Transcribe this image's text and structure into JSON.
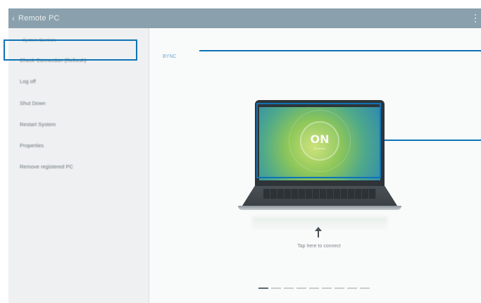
{
  "app": {
    "title": "Remote PC"
  },
  "sidebar": {
    "section_label": "System Controls",
    "items": [
      {
        "label": "Check Connection (Refresh)"
      },
      {
        "label": "Log off"
      },
      {
        "label": "Shut Down"
      },
      {
        "label": "Restart System"
      },
      {
        "label": "Properties"
      },
      {
        "label": "Remove registered PC"
      }
    ]
  },
  "main": {
    "pc_name": "BYNC",
    "screen": {
      "status": "ON",
      "substatus": "Available"
    },
    "hint": "Tap here to connect",
    "pager": {
      "total": 9,
      "current": 1
    }
  },
  "colors": {
    "titlebar": "#8aa0ad",
    "callout": "#0f73b5",
    "sidebar_bg": "#eef0f1"
  }
}
